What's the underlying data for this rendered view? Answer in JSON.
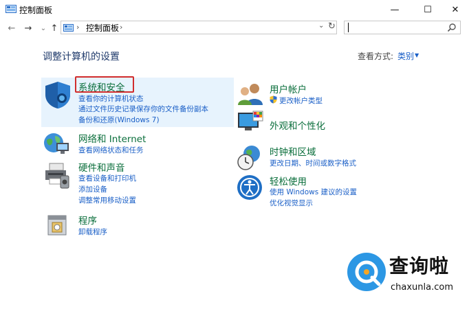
{
  "window": {
    "title": "控制面板",
    "controls": {
      "minimize": "—",
      "maximize": "☐",
      "close": "✕"
    }
  },
  "nav": {
    "back": "←",
    "forward": "→",
    "recent": "⌄",
    "up": "↑",
    "breadcrumb": "控制面板",
    "separator": "›",
    "dropdown": "⌄",
    "refresh": "↻",
    "search_placeholder": ""
  },
  "main": {
    "heading": "调整计算机的设置",
    "view_by": {
      "label": "查看方式:",
      "value": "类别",
      "arrow": "▼"
    }
  },
  "categories_left": [
    {
      "title": "系统和安全",
      "links": [
        "查看你的计算机状态",
        "通过文件历史记录保存你的文件备份副本",
        "备份和还原(Windows 7)"
      ]
    },
    {
      "title": "网络和 Internet",
      "links": [
        "查看网络状态和任务"
      ]
    },
    {
      "title": "硬件和声音",
      "links": [
        "查看设备和打印机",
        "添加设备",
        "调整常用移动设置"
      ]
    },
    {
      "title": "程序",
      "links": [
        "卸载程序"
      ]
    }
  ],
  "categories_right": [
    {
      "title": "用户帐户",
      "links": [
        "更改帐户类型"
      ]
    },
    {
      "title": "外观和个性化",
      "links": []
    },
    {
      "title": "时钟和区域",
      "links": [
        "更改日期、时间或数字格式"
      ]
    },
    {
      "title": "轻松使用",
      "links": [
        "使用 Windows 建议的设置",
        "优化视觉显示"
      ]
    }
  ],
  "watermark": {
    "name": "查询啦",
    "url": "chaxunla.com"
  },
  "colors": {
    "accent": "#1a5fc7",
    "category_title": "#0a6e3b",
    "highlight_bg": "#e7f3fd",
    "red_box": "#d12c2c",
    "watermark_blue": "#2c97e4"
  }
}
